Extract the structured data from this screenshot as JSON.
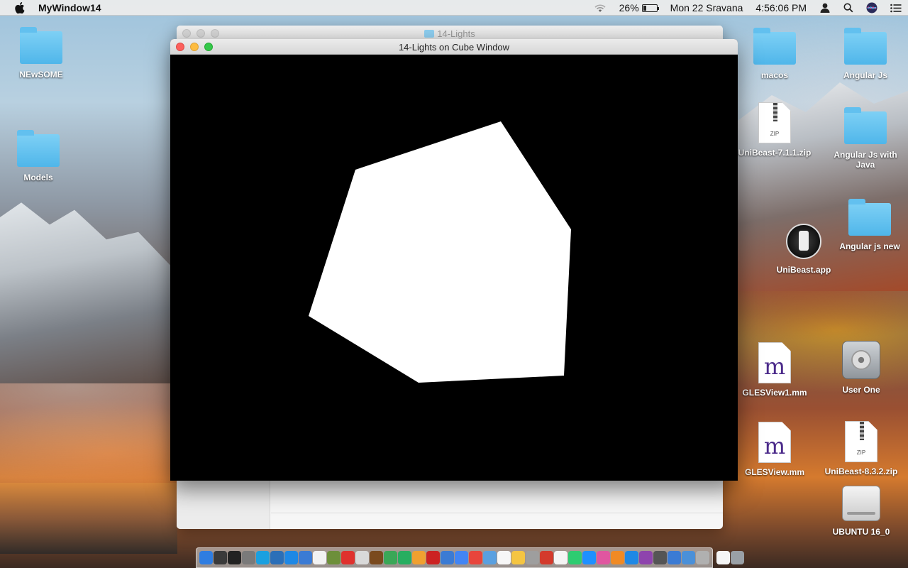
{
  "menubar": {
    "app_name": "MyWindow14",
    "battery_percent": "26%",
    "battery_level": 0.26,
    "datetime": "Mon 22 Sravana",
    "time": "4:56:06 PM"
  },
  "desktop": {
    "icons": [
      {
        "label": "NEwSOME",
        "kind": "folder"
      },
      {
        "label": "Models",
        "kind": "folder"
      },
      {
        "label": "macos",
        "kind": "folder"
      },
      {
        "label": "Angular Js",
        "kind": "folder"
      },
      {
        "label": "UniBeast-7.1.1.zip",
        "kind": "zip"
      },
      {
        "label": "Angular Js with Java",
        "kind": "folder"
      },
      {
        "label": "Angular js new",
        "kind": "folder"
      },
      {
        "label": "UniBeast.app",
        "kind": "app"
      },
      {
        "label": "GLESView1.mm",
        "kind": "source"
      },
      {
        "label": "User One",
        "kind": "disk"
      },
      {
        "label": "GLESView.mm",
        "kind": "source"
      },
      {
        "label": "UniBeast-8.3.2.zip",
        "kind": "zip"
      },
      {
        "label": "UBUNTU 16_0",
        "kind": "drive"
      }
    ],
    "doc_m_glyph": "m",
    "zip_badge": "ZIP"
  },
  "background_window": {
    "title": "14-Lights"
  },
  "main_window": {
    "title": "14-Lights on Cube Window",
    "background_color": "#000000",
    "shape_color": "#ffffff"
  },
  "dock": {
    "colors": [
      "#2f7de1",
      "#3a3a3a",
      "#222222",
      "#7a7a7a",
      "#1aa0e0",
      "#2b6fb8",
      "#1e88e5",
      "#3b7bd4",
      "#f2f2f2",
      "#6d8f3a",
      "#e0312e",
      "#d9d9d9",
      "#7a4a1e",
      "#3aa757",
      "#27ae60",
      "#f0a030",
      "#cc2222",
      "#3b7bd4",
      "#4285f4",
      "#e8453c",
      "#5aa0e0",
      "#f7f7f7",
      "#f5c542",
      "#9e9e9e",
      "#d33a2c",
      "#f4f4f4",
      "#2ecc71",
      "#1e90ff",
      "#e056a0",
      "#f08a24",
      "#1e88e5",
      "#8e44ad",
      "#555555",
      "#3b7bd4",
      "#4a90d9",
      "#b0b0b0",
      "#f5f5f5",
      "#9aa0a6"
    ]
  }
}
